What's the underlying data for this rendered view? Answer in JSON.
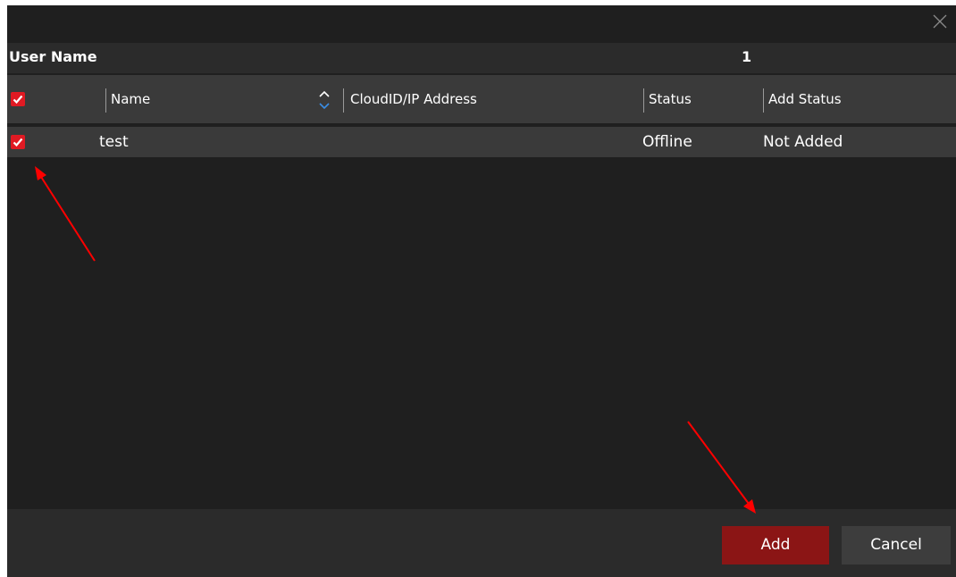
{
  "user_name": {
    "label": "User Name",
    "value": "1"
  },
  "table": {
    "columns": {
      "name": "Name",
      "cloud_ip": "CloudID/IP Address",
      "status": "Status",
      "add_status": "Add Status"
    },
    "rows": [
      {
        "checked": true,
        "name": "test",
        "cloud_ip": "",
        "status": "Offline",
        "add_status": "Not Added"
      }
    ]
  },
  "buttons": {
    "add": "Add",
    "cancel": "Cancel"
  },
  "icons": {
    "close": "close-icon",
    "sort": "sort-icon",
    "check": "check-icon"
  },
  "colors": {
    "accent": "#e01a23",
    "add_button": "#8b1515",
    "annotation_arrow": "#ff0000"
  }
}
